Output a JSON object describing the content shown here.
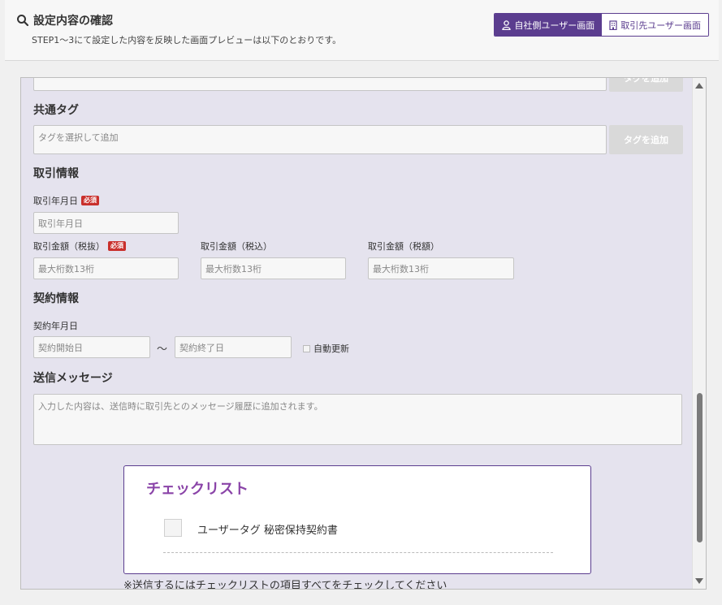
{
  "header": {
    "title": "設定内容の確認",
    "subtitle": "STEP1〜3にて設定した内容を反映した画面プレビューは以下のとおりです。",
    "toggle": {
      "self_label": "自社側ユーザー画面",
      "partner_label": "取引先ユーザー画面"
    }
  },
  "form": {
    "top_tag_button": "タグを追加",
    "common_tag": {
      "title": "共通タグ",
      "placeholder": "タグを選択して追加",
      "button": "タグを追加"
    },
    "trade": {
      "title": "取引情報",
      "date_label": "取引年月日",
      "date_placeholder": "取引年月日",
      "required_badge": "必須",
      "amount_ex_label": "取引金額（税抜）",
      "amount_in_label": "取引金額（税込）",
      "amount_tax_label": "取引金額（税額）",
      "amount_placeholder": "最大桁数13桁"
    },
    "contract": {
      "title": "契約情報",
      "date_label": "契約年月日",
      "start_placeholder": "契約開始日",
      "tilde": "〜",
      "end_placeholder": "契約終了日",
      "auto_renew": "自動更新"
    },
    "message": {
      "title": "送信メッセージ",
      "placeholder": "入力した内容は、送信時に取引先とのメッセージ履歴に追加されます。"
    }
  },
  "checklist": {
    "title": "チェックリスト",
    "items": [
      {
        "label": "ユーザータグ 秘密保持契約書",
        "checked": false
      }
    ],
    "notice": "※送信するにはチェックリストの項目すべてをチェックしてください"
  },
  "colors": {
    "accent": "#5b3d8f",
    "checklist_title": "#8a44a8",
    "required": "#c9302c",
    "panel_bg": "#e5e3ee"
  }
}
